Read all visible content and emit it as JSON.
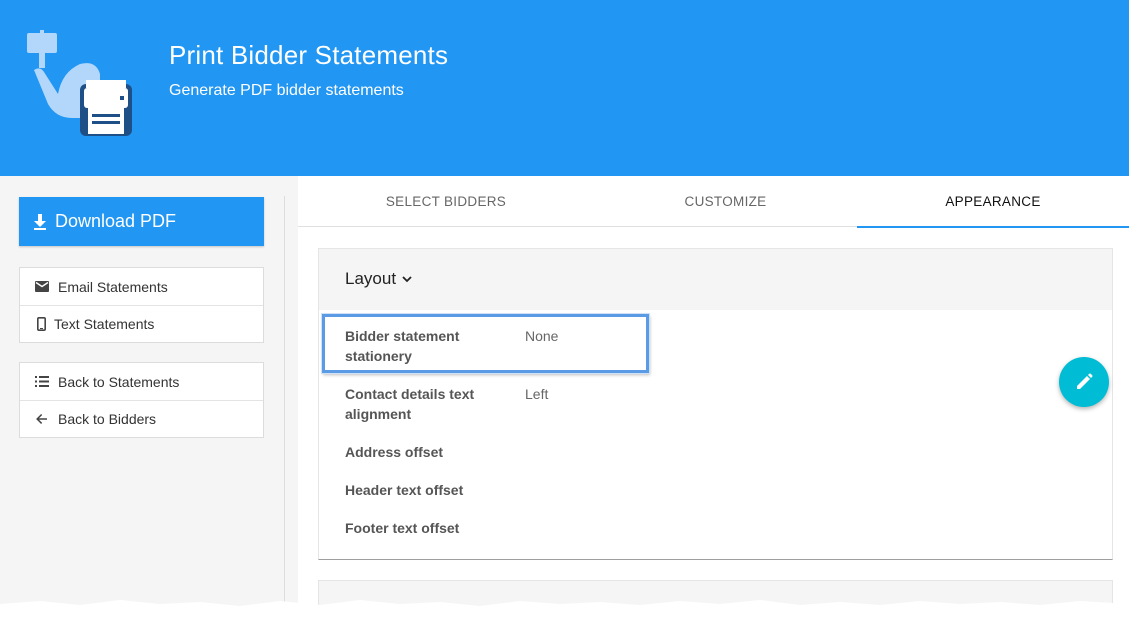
{
  "header": {
    "title": "Print Bidder Statements",
    "subtitle": "Generate PDF bidder statements",
    "logo_icon": "bidder-printer-icon"
  },
  "sidebar": {
    "download_label": "Download PDF",
    "group1": [
      {
        "label": "Email Statements",
        "icon": "envelope-icon"
      },
      {
        "label": "Text Statements",
        "icon": "phone-icon"
      }
    ],
    "group2": [
      {
        "label": "Back to Statements",
        "icon": "list-icon"
      },
      {
        "label": "Back to Bidders",
        "icon": "arrow-left-icon"
      }
    ]
  },
  "tabs": [
    {
      "label": "SELECT BIDDERS",
      "active": false
    },
    {
      "label": "CUSTOMIZE",
      "active": false
    },
    {
      "label": "APPEARANCE",
      "active": true
    }
  ],
  "layout_card": {
    "heading": "Layout",
    "rows": [
      {
        "label": "Bidder statement stationery",
        "value": "None"
      },
      {
        "label": "Contact details text alignment",
        "value": "Left"
      },
      {
        "label": "Address offset",
        "value": ""
      },
      {
        "label": "Header text offset",
        "value": ""
      },
      {
        "label": "Footer text offset",
        "value": ""
      }
    ]
  },
  "colors": {
    "primary": "#2196f3",
    "fab": "#00bcd4",
    "highlight": "#5b9be6"
  }
}
